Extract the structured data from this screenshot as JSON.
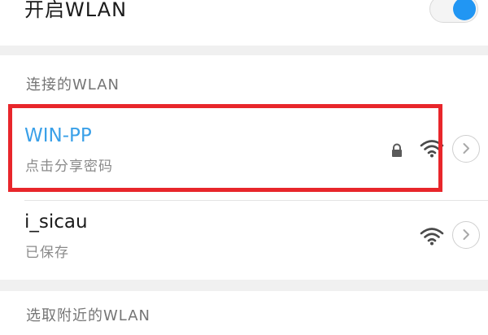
{
  "wlan_toggle": {
    "label": "开启WLAN",
    "on": true,
    "accent": "#2196f3"
  },
  "connected_section": {
    "title": "连接的WLAN"
  },
  "networks": [
    {
      "name": "WIN-PP",
      "status": "点击分享密码",
      "locked": true,
      "name_color": "#3aa0e8"
    },
    {
      "name": "i_sicau",
      "status": "已保存",
      "locked": false,
      "name_color": "#1b1b1b"
    }
  ],
  "nearby_section": {
    "title": "选取附近的WLAN"
  },
  "icons": [
    "lock-icon",
    "wifi-icon",
    "chevron-right-icon"
  ],
  "highlight_color": "#e8262b"
}
